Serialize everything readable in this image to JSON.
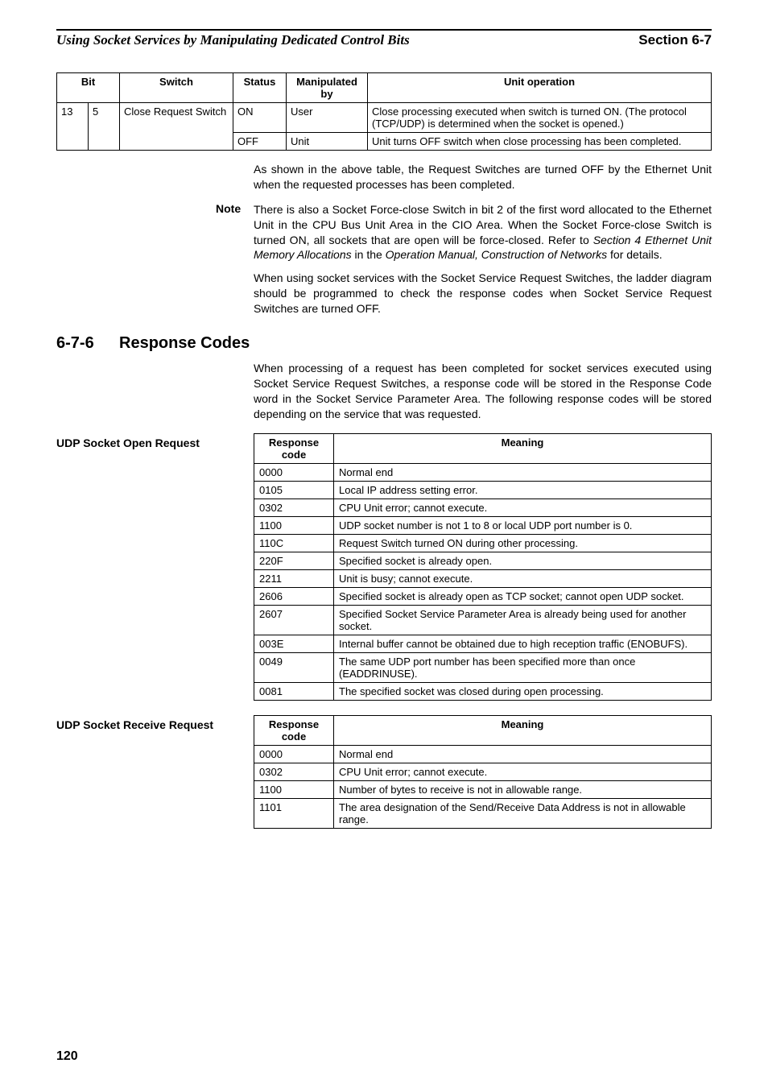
{
  "header": {
    "left": "Using Socket Services by Manipulating Dedicated Control Bits",
    "right": "Section 6-7"
  },
  "switch_table": {
    "headers": [
      "Bit",
      "",
      "Switch",
      "Status",
      "Manipulated by",
      "Unit operation"
    ],
    "rows": [
      {
        "bit_a": "13",
        "bit_b": "5",
        "switch": "Close Request Switch",
        "status": "ON",
        "manip": "User",
        "op": "Close processing executed when switch is turned ON. (The protocol (TCP/UDP) is determined when the socket is opened.)"
      },
      {
        "status": "OFF",
        "manip": "Unit",
        "op": "Unit turns OFF switch when close processing has been completed."
      }
    ]
  },
  "para1": "As shown in the above table, the Request Switches are turned OFF by the Ethernet Unit when the requested processes has been completed.",
  "note": {
    "label": "Note",
    "p1a": "There is also a Socket Force-close Switch in bit 2 of the first word allocated to the Ethernet Unit in the CPU Bus Unit Area in the CIO Area. When the Socket Force-close Switch is turned ON, all sockets that are open will be force-closed. Refer to ",
    "p1b": "Section 4 Ethernet Unit Memory Allocations",
    "p1c": " in the ",
    "p1d": "Operation Manual, Construction of Networks",
    "p1e": " for details.",
    "p2": "When using socket services with the Socket Service Request Switches, the ladder diagram should be programmed to check the response codes when Socket Service Request Switches are turned OFF."
  },
  "section": {
    "num": "6-7-6",
    "title": "Response Codes",
    "body": "When processing of a request has been completed for socket services executed using Socket Service Request Switches, a response code will be stored in the Response Code word in the Socket Service Parameter Area. The following response codes will be stored depending on the service that was requested."
  },
  "udp_open": {
    "label": "UDP Socket Open Request",
    "headers": [
      "Response code",
      "Meaning"
    ],
    "rows": [
      {
        "code": "0000",
        "meaning": "Normal end"
      },
      {
        "code": "0105",
        "meaning": "Local IP address setting error."
      },
      {
        "code": "0302",
        "meaning": "CPU Unit error; cannot execute."
      },
      {
        "code": "1100",
        "meaning": "UDP socket number is not 1 to 8 or local UDP port number is 0."
      },
      {
        "code": "110C",
        "meaning": "Request Switch turned ON during other processing."
      },
      {
        "code": "220F",
        "meaning": "Specified socket is already open."
      },
      {
        "code": "2211",
        "meaning": "Unit is busy; cannot execute."
      },
      {
        "code": "2606",
        "meaning": "Specified socket is already open as TCP socket; cannot open UDP socket."
      },
      {
        "code": "2607",
        "meaning": "Specified Socket Service Parameter Area is already being used for another socket."
      },
      {
        "code": "003E",
        "meaning": "Internal buffer cannot be obtained due to high reception traffic (ENOBUFS)."
      },
      {
        "code": "0049",
        "meaning": "The same UDP port number has been specified more than once (EADDRINUSE)."
      },
      {
        "code": "0081",
        "meaning": "The specified socket was closed during open processing."
      }
    ]
  },
  "udp_recv": {
    "label": "UDP Socket Receive Request",
    "headers": [
      "Response code",
      "Meaning"
    ],
    "rows": [
      {
        "code": "0000",
        "meaning": "Normal end"
      },
      {
        "code": "0302",
        "meaning": "CPU Unit error; cannot execute."
      },
      {
        "code": "1100",
        "meaning": "Number of bytes to receive is not in allowable range."
      },
      {
        "code": "1101",
        "meaning": "The area designation of the Send/Receive Data Address is not in allowable range."
      }
    ]
  },
  "page_number": "120"
}
